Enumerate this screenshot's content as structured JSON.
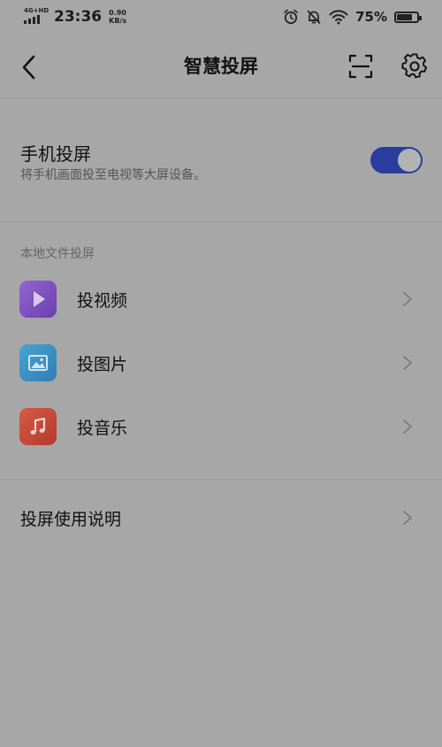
{
  "status_bar": {
    "network": "4G+HD",
    "time": "23:36",
    "speed_value": "0.90",
    "speed_unit": "KB/s",
    "battery_percent": "75%",
    "battery_level": 0.75
  },
  "navbar": {
    "title": "智慧投屏"
  },
  "screen_cast": {
    "title": "手机投屏",
    "subtitle": "将手机画面投至电视等大屏设备。",
    "enabled": true
  },
  "local_files": {
    "header": "本地文件投屏",
    "items": [
      {
        "label": "投视频",
        "icon": "video-play-icon",
        "color": "#7e4bb8"
      },
      {
        "label": "投图片",
        "icon": "picture-icon",
        "color": "#3d8fbf"
      },
      {
        "label": "投音乐",
        "icon": "music-note-icon",
        "color": "#c4473a"
      }
    ]
  },
  "help": {
    "label": "投屏使用说明"
  }
}
